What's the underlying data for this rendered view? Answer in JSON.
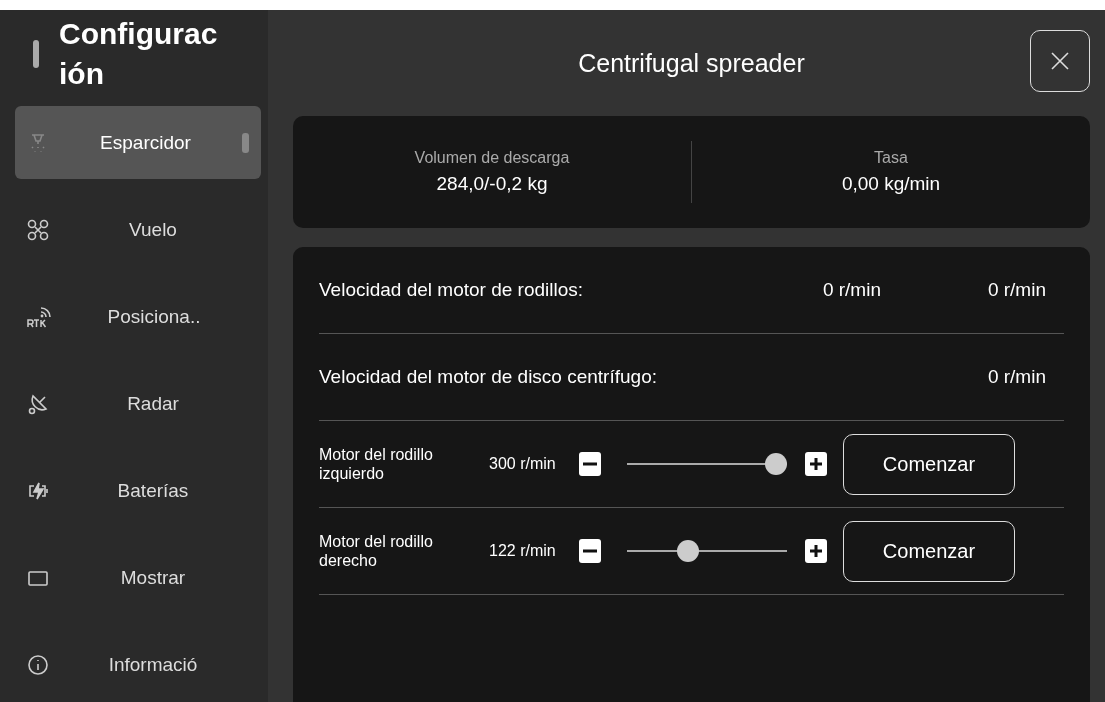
{
  "sidebar": {
    "title": "Configuración",
    "items": [
      {
        "label": "Esparcidor",
        "selected": true
      },
      {
        "label": "Vuelo",
        "selected": false
      },
      {
        "label": "Posiciona..",
        "selected": false
      },
      {
        "label": "Radar",
        "selected": false
      },
      {
        "label": "Baterías",
        "selected": false
      },
      {
        "label": "Mostrar",
        "selected": false
      },
      {
        "label": "Informació",
        "selected": false
      }
    ]
  },
  "header": {
    "title": "Centrifugal spreader"
  },
  "stats": [
    {
      "label": "Volumen de descarga",
      "value": "284,0/-0,2 kg"
    },
    {
      "label": "Tasa",
      "value": "0,00 kg/min"
    }
  ],
  "rows": [
    {
      "kind": "reading",
      "label": "Velocidad del motor de rodillos:",
      "readings": [
        "0 r/min",
        "0 r/min"
      ]
    },
    {
      "kind": "reading",
      "label": "Velocidad del motor de disco centrífugo:",
      "readings": [
        "0 r/min"
      ]
    },
    {
      "kind": "slider",
      "label": "Motor del rodillo izquierdo",
      "value": "300 r/min",
      "level": 0.93,
      "button": "Comenzar"
    },
    {
      "kind": "slider",
      "label": "Motor del rodillo derecho",
      "value": "122 r/min",
      "level": 0.38,
      "button": "Comenzar"
    }
  ]
}
